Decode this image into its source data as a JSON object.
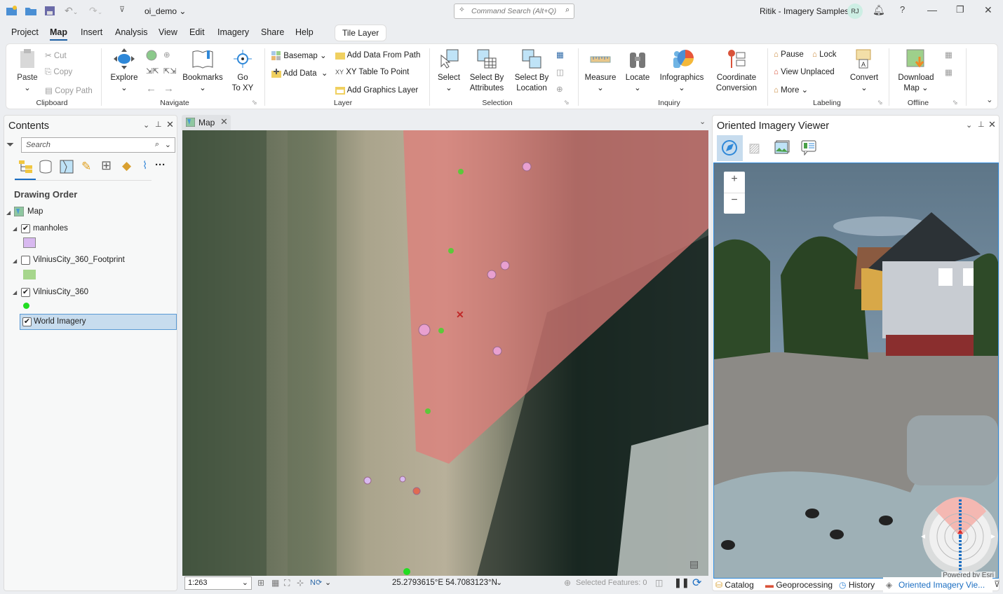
{
  "title_bar": {
    "project_name": "oi_demo",
    "command_search_placeholder": "Command Search (Alt+Q)",
    "user_label": "Ritik - Imagery Samples",
    "avatar_initials": "RJ",
    "help": "?"
  },
  "menu": {
    "tabs": [
      "Project",
      "Map",
      "Insert",
      "Analysis",
      "View",
      "Edit",
      "Imagery",
      "Share",
      "Help"
    ],
    "active_tab": "Map",
    "contextual_tab": "Tile Layer"
  },
  "ribbon": {
    "clipboard": {
      "group": "Clipboard",
      "paste": "Paste",
      "cut": "Cut",
      "copy": "Copy",
      "copy_path": "Copy Path"
    },
    "navigate": {
      "group": "Navigate",
      "explore": "Explore",
      "bookmarks": "Bookmarks",
      "go_to_xy_1": "Go",
      "go_to_xy_2": "To XY"
    },
    "layer": {
      "group": "Layer",
      "basemap": "Basemap",
      "add_data": "Add Data",
      "add_data_from_path": "Add Data From Path",
      "xy_table_to_point": "XY Table To Point",
      "add_graphics_layer": "Add Graphics Layer"
    },
    "selection": {
      "group": "Selection",
      "select": "Select",
      "select_by_attributes_1": "Select By",
      "select_by_attributes_2": "Attributes",
      "select_by_location_1": "Select By",
      "select_by_location_2": "Location"
    },
    "inquiry": {
      "group": "Inquiry",
      "measure": "Measure",
      "locate": "Locate",
      "infographics": "Infographics",
      "coordinate_conversion_1": "Coordinate",
      "coordinate_conversion_2": "Conversion"
    },
    "labeling": {
      "group": "Labeling",
      "pause": "Pause",
      "lock": "Lock",
      "view_unplaced": "View Unplaced",
      "more": "More",
      "convert": "Convert"
    },
    "offline": {
      "group": "Offline",
      "download_map_1": "Download",
      "download_map_2": "Map"
    }
  },
  "contents": {
    "title": "Contents",
    "search_placeholder": "Search",
    "heading": "Drawing Order",
    "map_label": "Map",
    "layers": [
      {
        "name": "manholes",
        "checked": true,
        "symbol_color": "#d8b9f0"
      },
      {
        "name": "VilniusCity_360_Footprint",
        "checked": false,
        "symbol_color": "#a6d68c"
      },
      {
        "name": "VilniusCity_360",
        "checked": true,
        "symbol_color": "#22dd22"
      },
      {
        "name": "World Imagery",
        "checked": true,
        "selected": true
      }
    ],
    "check_mark": "✔"
  },
  "map": {
    "tab_label": "Map",
    "scale": "1:263",
    "coordinates": "25.2793615°E 54.7083123°N",
    "selected_features": "Selected Features: 0"
  },
  "oiv": {
    "title": "Oriented Imagery Viewer",
    "zoom_in": "+",
    "zoom_out": "−",
    "attribution": "Powered by Esri"
  },
  "bottom_tabs": [
    "Catalog",
    "Geoprocessing",
    "History",
    "Oriented Imagery Vie..."
  ],
  "colors": {
    "accent": "#1b5fa3",
    "footprint": "#e07b78",
    "manhole": "#e8a0d0",
    "camera_point": "#5cc83a"
  }
}
